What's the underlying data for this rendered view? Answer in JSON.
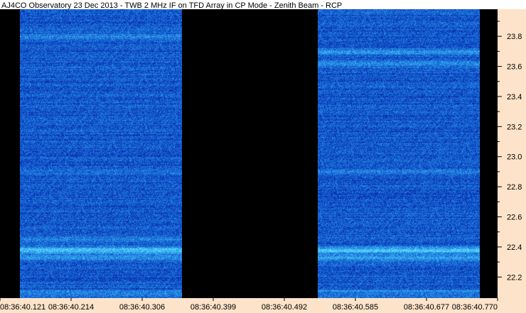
{
  "chart_data": {
    "type": "heatmap",
    "title": "AJ4CO Observatory 23 Dec 2013 - TWB 2 MHz IF on TFD Array in CP Mode - Zenith Beam - RCP",
    "xlabel": "",
    "ylabel": "",
    "x_tick_labels": [
      "08:36:40.121",
      "08:36:40.214",
      "08:36:40.306",
      "08:36:40.399",
      "08:36:40.492",
      "08:36:40.585",
      "08:36:40.677",
      "08:36:40.770"
    ],
    "y_ticks": [
      22.2,
      22.4,
      22.6,
      22.8,
      23.0,
      23.2,
      23.4,
      23.6,
      23.8
    ],
    "y_tick_labels": [
      "22.2",
      "22.4",
      "22.6",
      "22.8",
      "23.0",
      "23.2",
      "23.4",
      "23.6",
      "23.8"
    ],
    "ylim": [
      22.06,
      23.98
    ],
    "grid": false,
    "colors": {
      "background": "#000000",
      "axis_panel": "#fde3c9",
      "low_intensity": "#0a1a8c",
      "high_intensity": "#5fe0ff"
    },
    "data_blocks": [
      {
        "name": "",
        "start_fraction": 0.0,
        "end_fraction": 0.353,
        "emission_bands": [
          {
            "freq": 22.38,
            "intensity": 0.95
          },
          {
            "freq": 22.33,
            "intensity": 0.55
          },
          {
            "freq": 22.45,
            "intensity": 0.35
          },
          {
            "freq": 23.8,
            "intensity": 0.4
          },
          {
            "freq": 22.9,
            "intensity": 0.25
          }
        ]
      },
      {
        "name": "",
        "start_fraction": 0.647,
        "end_fraction": 1.0,
        "emission_bands": [
          {
            "freq": 22.38,
            "intensity": 1.0
          },
          {
            "freq": 22.33,
            "intensity": 0.55
          },
          {
            "freq": 23.7,
            "intensity": 0.5
          },
          {
            "freq": 23.62,
            "intensity": 0.4
          },
          {
            "freq": 22.9,
            "intensity": 0.25
          }
        ]
      }
    ]
  }
}
